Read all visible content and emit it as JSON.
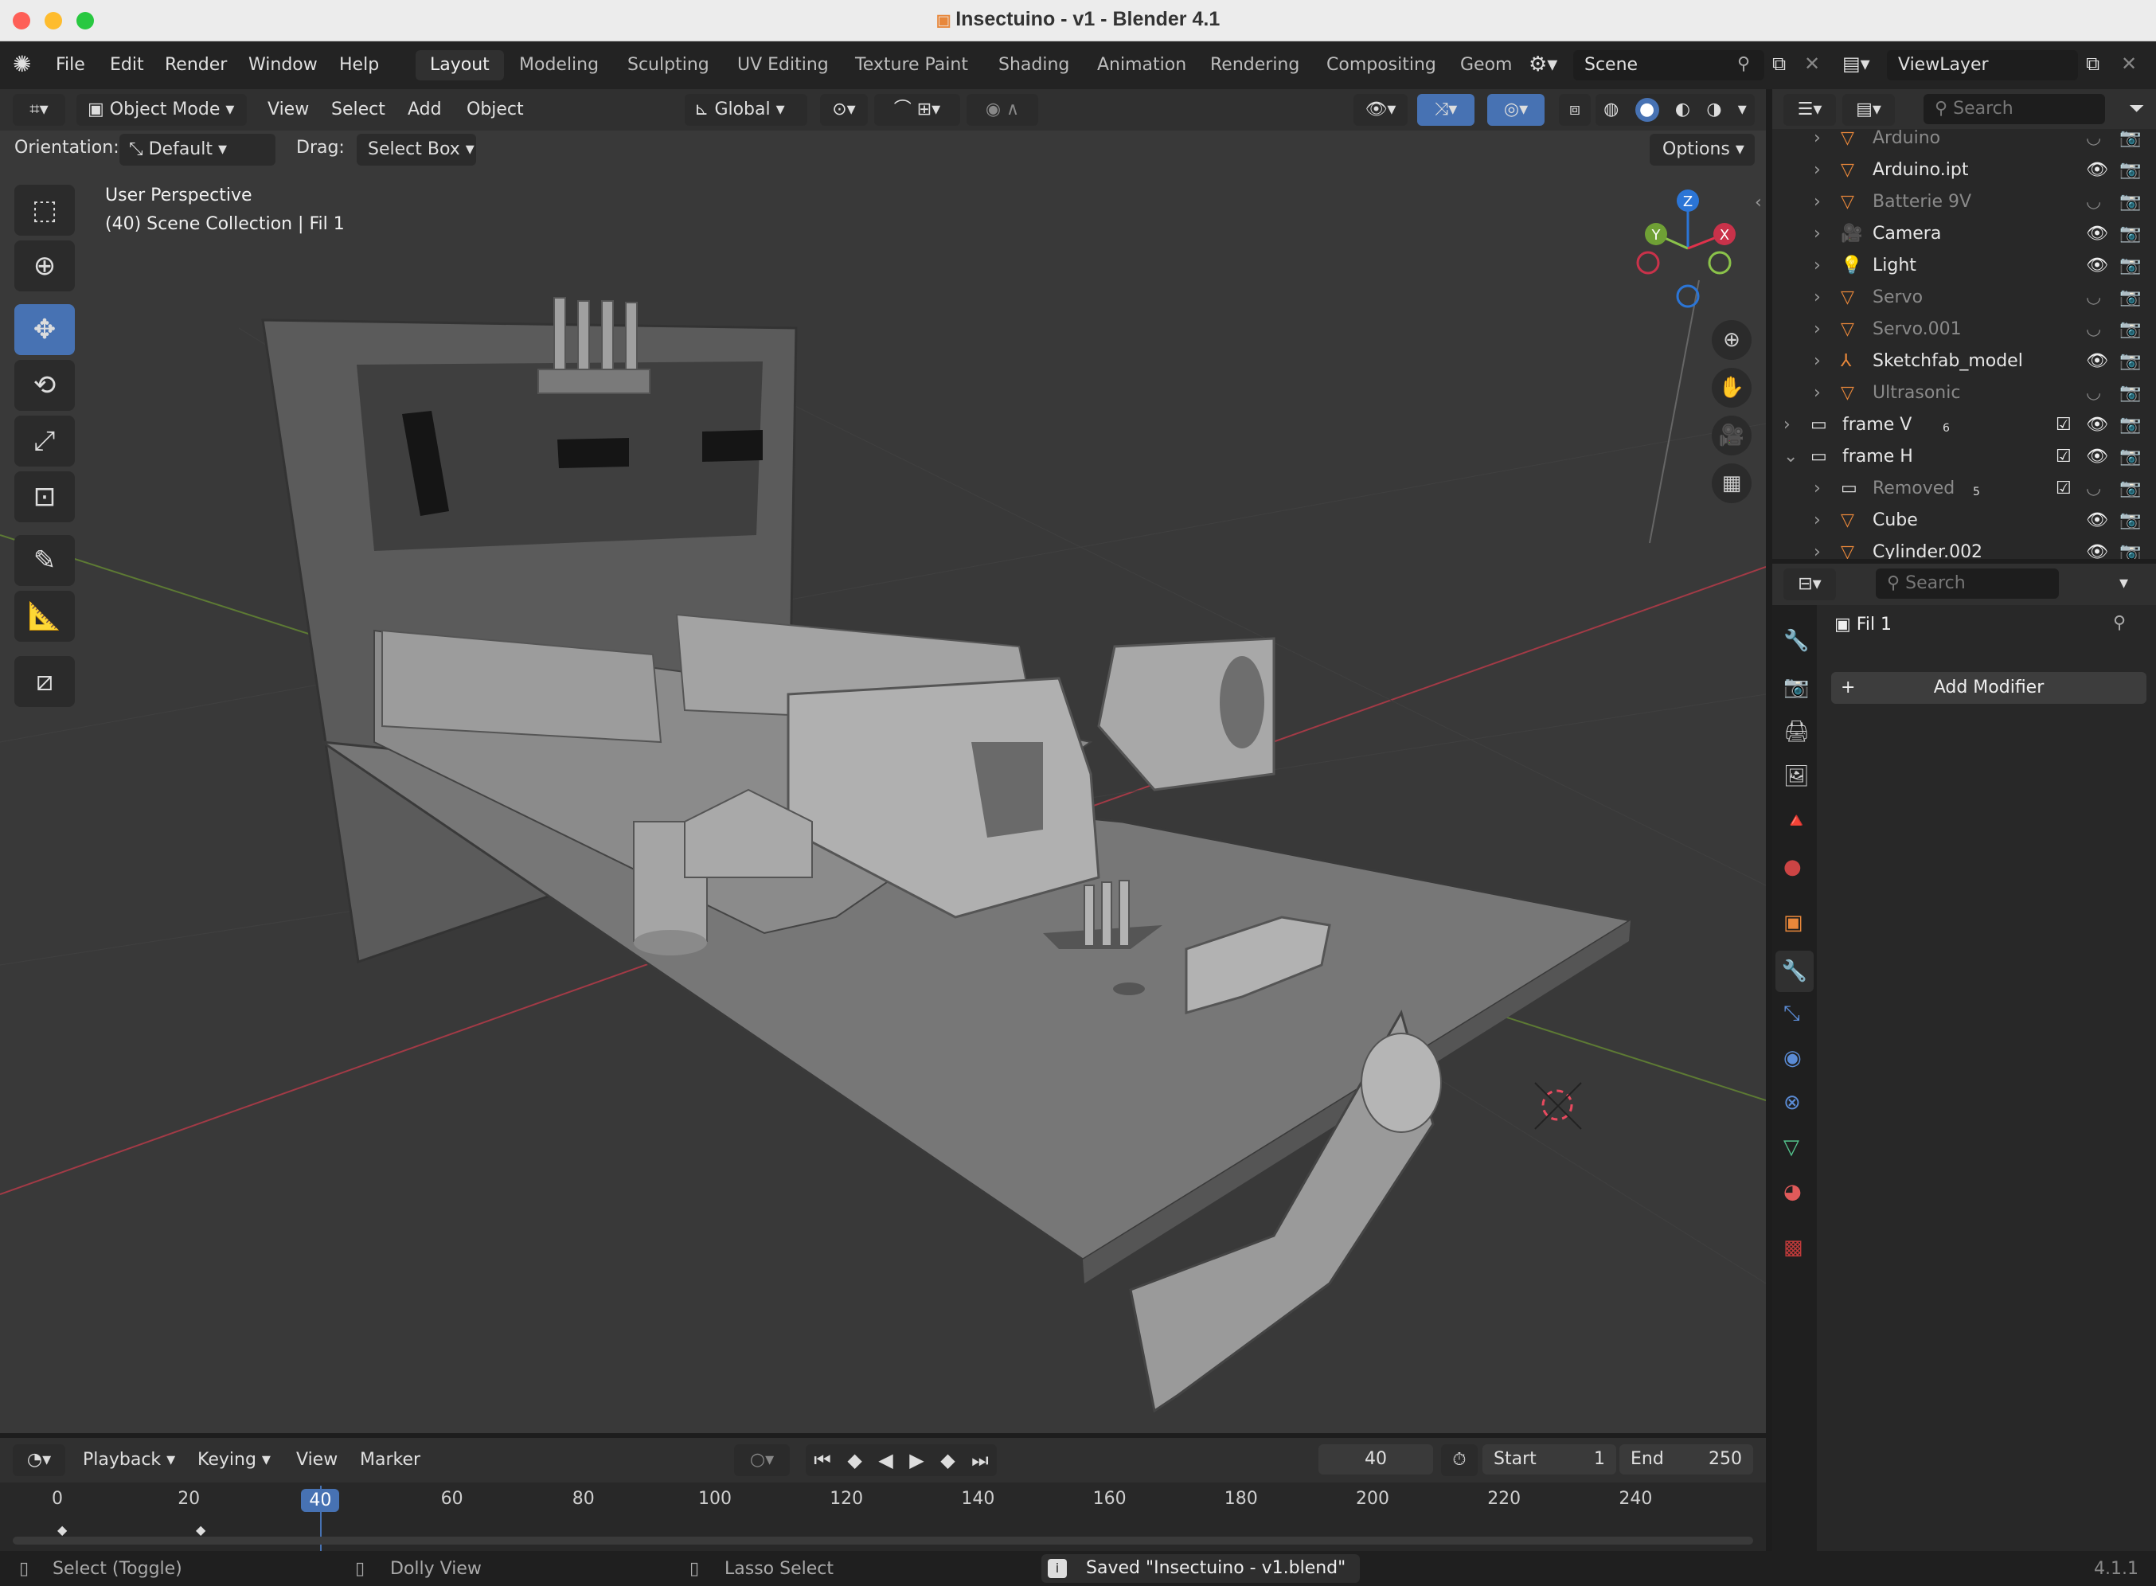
{
  "window": {
    "title": "Insectuino - v1 - Blender 4.1"
  },
  "menu": [
    "File",
    "Edit",
    "Render",
    "Window",
    "Help"
  ],
  "workspaces": [
    "Layout",
    "Modeling",
    "Sculpting",
    "UV Editing",
    "Texture Paint",
    "Shading",
    "Animation",
    "Rendering",
    "Compositing",
    "Geom"
  ],
  "active_workspace": "Layout",
  "scene": {
    "name": "Scene"
  },
  "viewlayer": {
    "name": "ViewLayer"
  },
  "viewport_header": {
    "mode": "Object Mode",
    "menus": [
      "View",
      "Select",
      "Add",
      "Object"
    ],
    "transform_orientation": "Global",
    "orientation_label": "Orientation:",
    "orientation_value": "Default",
    "drag_label": "Drag:",
    "drag_value": "Select Box",
    "options": "Options"
  },
  "viewport": {
    "perspective": "User Perspective",
    "collection_info": "(40) Scene Collection | Fil 1",
    "gizmo_axes": [
      "Z",
      "Y",
      "X"
    ]
  },
  "outliner": {
    "search_placeholder": "Search",
    "rows": [
      {
        "name": "Arduino",
        "type": "mesh",
        "visible": false,
        "indent": 1
      },
      {
        "name": "Arduino.ipt",
        "type": "mesh",
        "visible": true,
        "indent": 1
      },
      {
        "name": "Batterie 9V",
        "type": "mesh",
        "visible": false,
        "indent": 1
      },
      {
        "name": "Camera",
        "type": "camera",
        "visible": true,
        "indent": 1
      },
      {
        "name": "Light",
        "type": "light",
        "visible": true,
        "indent": 1
      },
      {
        "name": "Servo",
        "type": "mesh",
        "visible": false,
        "indent": 1
      },
      {
        "name": "Servo.001",
        "type": "mesh",
        "visible": false,
        "indent": 1
      },
      {
        "name": "Sketchfab_model",
        "type": "empty",
        "visible": true,
        "indent": 1
      },
      {
        "name": "Ultrasonic",
        "type": "mesh",
        "visible": false,
        "indent": 1
      },
      {
        "name": "frame V",
        "type": "collection",
        "visible": true,
        "indent": 0,
        "badge": "6"
      },
      {
        "name": "frame H",
        "type": "collection",
        "visible": true,
        "indent": 0,
        "expanded": true
      },
      {
        "name": "Removed",
        "type": "collection",
        "visible": false,
        "indent": 1,
        "badge": "5"
      },
      {
        "name": "Cube",
        "type": "mesh",
        "visible": true,
        "indent": 1
      },
      {
        "name": "Cylinder.002",
        "type": "mesh",
        "visible": true,
        "indent": 1
      }
    ]
  },
  "properties": {
    "search_placeholder": "Search",
    "object_name": "Fil 1",
    "add_modifier": "Add Modifier"
  },
  "timeline": {
    "menus": [
      "Playback",
      "Keying",
      "View",
      "Marker"
    ],
    "current_frame": "40",
    "start_label": "Start",
    "start": "1",
    "end_label": "End",
    "end": "250",
    "ticks": [
      "0",
      "20",
      "40",
      "60",
      "80",
      "100",
      "120",
      "140",
      "160",
      "180",
      "200",
      "220",
      "240"
    ]
  },
  "status_bar": {
    "select": "Select (Toggle)",
    "dolly": "Dolly View",
    "lasso": "Lasso Select",
    "message": "Saved \"Insectuino - v1.blend\"",
    "version": "4.1.1"
  },
  "colors": {
    "accent": "#4772b3",
    "x_axis": "#e0324b",
    "y_axis": "#8bc34a",
    "z_axis": "#2b75d6",
    "mesh_icon": "#e8873a",
    "data_icon": "#54c48d"
  }
}
